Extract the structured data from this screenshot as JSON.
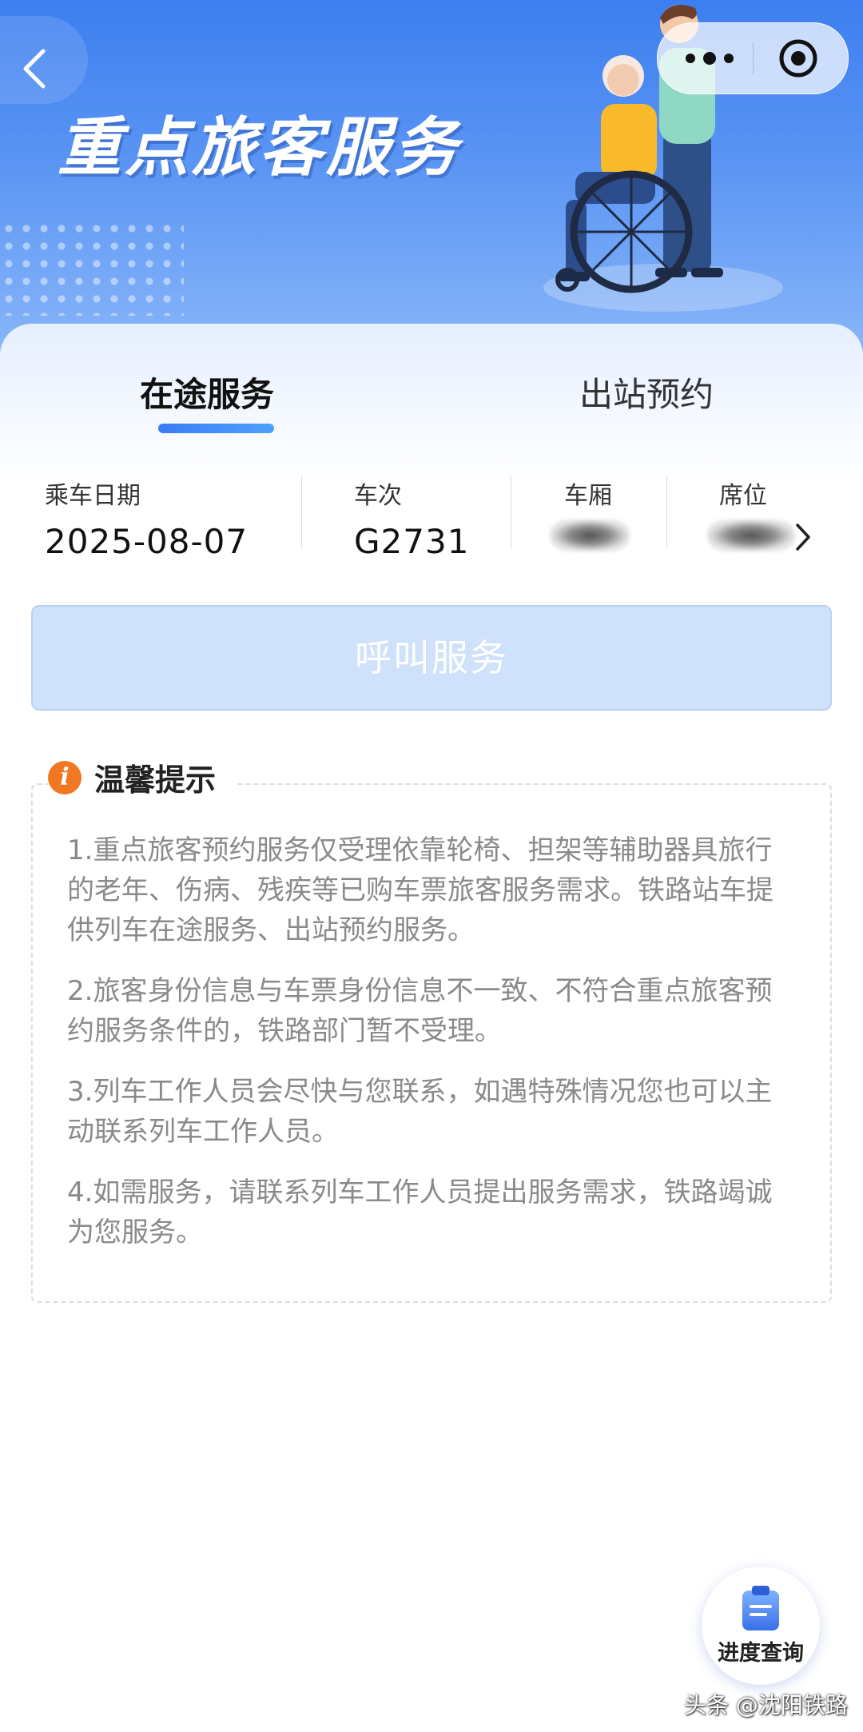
{
  "header": {
    "title": "重点旅客服务",
    "back_icon": "chevron-left-icon",
    "more_icon": "more-dots-icon",
    "close_icon": "target-close-icon"
  },
  "tabs": [
    {
      "label": "在途服务",
      "active": true
    },
    {
      "label": "出站预约",
      "active": false
    }
  ],
  "ticket": {
    "date_label": "乘车日期",
    "date_value": "2025-08-07",
    "train_label": "车次",
    "train_value": "G2731",
    "car_label": "车厢",
    "seat_label": "席位"
  },
  "call_button": "呼叫服务",
  "tips": {
    "title": "温馨提示",
    "items": [
      "1.重点旅客预约服务仅受理依靠轮椅、担架等辅助器具旅行的老年、伤病、残疾等已购车票旅客服务需求。铁路站车提供列车在途服务、出站预约服务。",
      "2.旅客身份信息与车票身份信息不一致、不符合重点旅客预约服务条件的，铁路部门暂不受理。",
      "3.列车工作人员会尽快与您联系，如遇特殊情况您也可以主动联系列车工作人员。",
      "4.如需服务，请联系列车工作人员提出服务需求，铁路竭诚为您服务。"
    ]
  },
  "fab": {
    "label": "进度查询",
    "icon": "clipboard-icon"
  },
  "watermark": "头条 @沈阳铁路",
  "colors": {
    "primary": "#3b7cf5",
    "accent": "#f07822",
    "button_disabled": "#cfe1fb"
  }
}
